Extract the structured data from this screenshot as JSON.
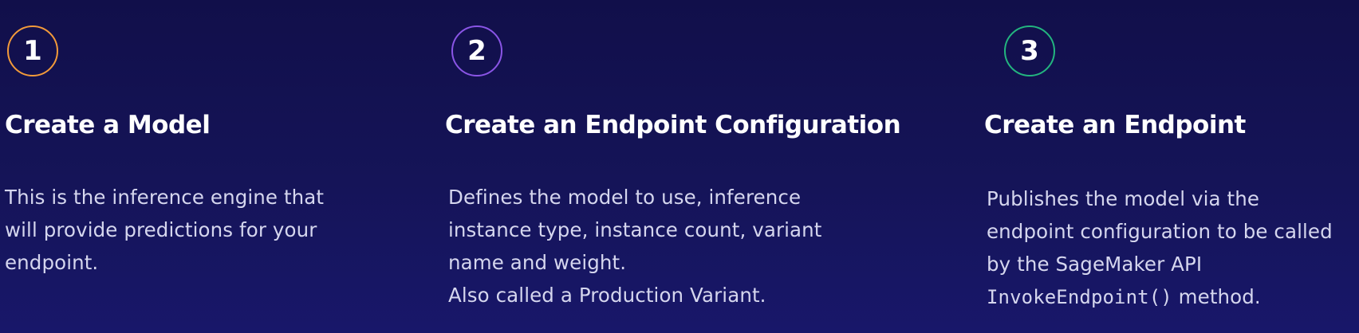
{
  "colors": {
    "background": "#131253",
    "step1_accent": "#f29a3a",
    "step2_accent": "#8a55e6",
    "step3_accent": "#23b57f",
    "text_primary": "#ffffff",
    "text_secondary": "#d5d6ee"
  },
  "steps": [
    {
      "number": "1",
      "title": "Create a Model",
      "lines": [
        "This is the inference engine that",
        "will provide predictions for your",
        "endpoint."
      ]
    },
    {
      "number": "2",
      "title": "Create an Endpoint Configuration",
      "lines": [
        "Defines the model to use, inference",
        "instance type, instance count, variant",
        "name and weight.",
        "Also called a Production Variant."
      ]
    },
    {
      "number": "3",
      "title": "Create an Endpoint",
      "lines": [
        "Publishes the model via the",
        "endpoint configuration to be called",
        "by the SageMaker API"
      ],
      "code": "InvokeEndpoint()",
      "code_suffix": " method."
    }
  ]
}
